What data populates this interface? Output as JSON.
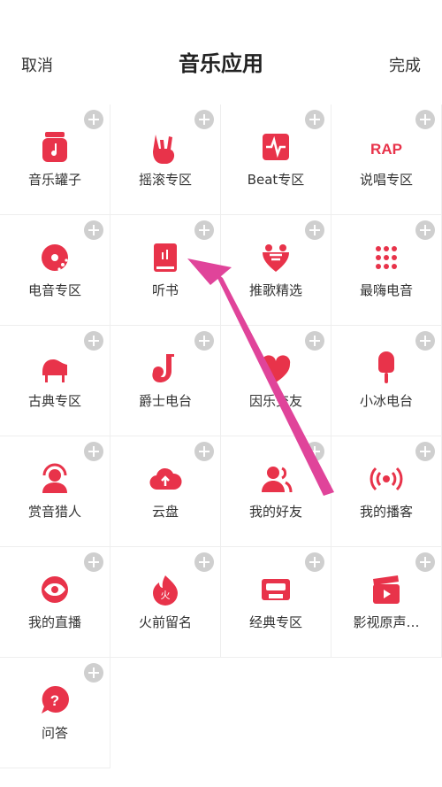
{
  "header": {
    "cancel_label": "取消",
    "title": "音乐应用",
    "done_label": "完成"
  },
  "accent_color": "#e8334a",
  "annotation_color": "#e0449a",
  "apps": [
    {
      "label": "音乐罐子",
      "icon": "music-jar-icon"
    },
    {
      "label": "摇滚专区",
      "icon": "rock-hand-icon"
    },
    {
      "label": "Beat专区",
      "icon": "beat-icon"
    },
    {
      "label": "说唱专区",
      "icon": "rap-icon"
    },
    {
      "label": "电音专区",
      "icon": "electronic-disc-icon"
    },
    {
      "label": "听书",
      "icon": "audiobook-icon"
    },
    {
      "label": "推歌精选",
      "icon": "recommend-icon"
    },
    {
      "label": "最嗨电音",
      "icon": "dots-icon"
    },
    {
      "label": "古典专区",
      "icon": "piano-icon"
    },
    {
      "label": "爵士电台",
      "icon": "saxophone-icon"
    },
    {
      "label": "因乐交友",
      "icon": "heart-chat-icon"
    },
    {
      "label": "小冰电台",
      "icon": "popsicle-icon"
    },
    {
      "label": "赏音猎人",
      "icon": "headphone-person-icon"
    },
    {
      "label": "云盘",
      "icon": "cloud-upload-icon"
    },
    {
      "label": "我的好友",
      "icon": "friends-icon"
    },
    {
      "label": "我的播客",
      "icon": "broadcast-icon"
    },
    {
      "label": "我的直播",
      "icon": "live-eye-icon"
    },
    {
      "label": "火前留名",
      "icon": "fire-icon"
    },
    {
      "label": "经典专区",
      "icon": "cassette-icon"
    },
    {
      "label": "影视原声…",
      "icon": "clapperboard-icon"
    },
    {
      "label": "问答",
      "icon": "question-icon"
    }
  ]
}
